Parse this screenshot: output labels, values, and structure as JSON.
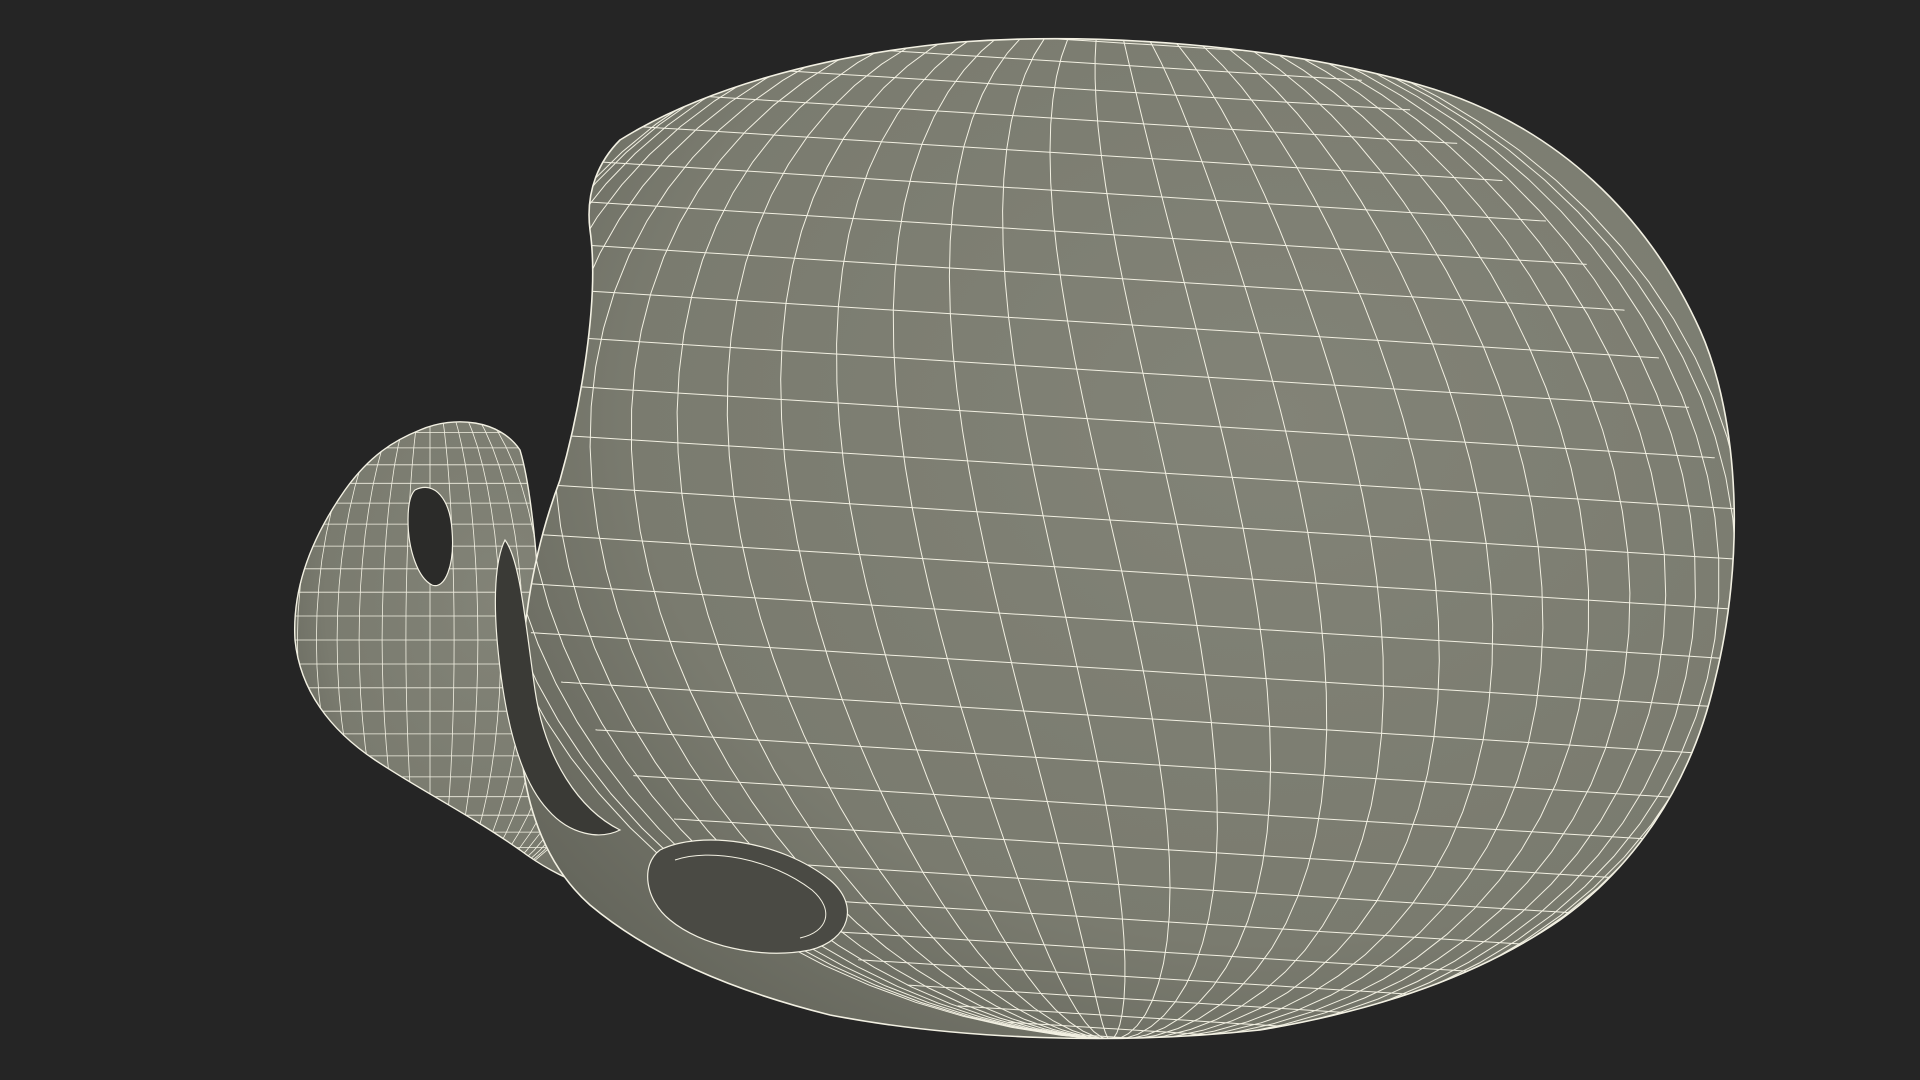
{
  "scene": {
    "subject": "skull-wireframe",
    "background_color": "#252525",
    "surface_color": "#7c7d71",
    "surface_shadow_color": "#5d5e55",
    "wire_color": "#f2f0e2",
    "socket_color": "#2a2a28"
  }
}
